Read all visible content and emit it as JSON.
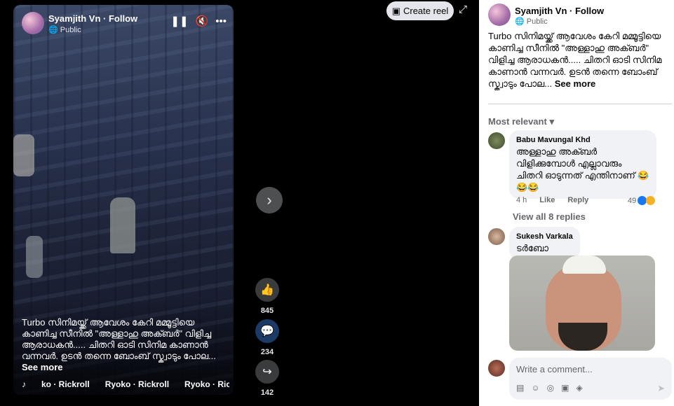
{
  "video": {
    "author": "Syamjith Vn · Follow",
    "privacy": "Public",
    "caption": "Turbo സിനിമയ്ക്ക് ആവേശം കേറി മമ്മൂട്ടിയെ കാണിച്ച സീനിൽ \"അള്ളാഹു അക്ബർ\" വിളിച്ച ആരാധകൻ..... ചിതറി ഓടി സിനിമ കാണാൻ വന്നവർ. ഉടൻ തന്നെ ബോംബ് സ്ക്വാടും പോല...",
    "see_more": "See more",
    "music": [
      "ko · Rickroll",
      "Ryoko · Rickroll",
      "Ryoko · Rickroll"
    ],
    "controls": {
      "pause_icon": "pause-icon",
      "mute_icon": "volume-icon",
      "more_icon": "more-icon"
    }
  },
  "actions": {
    "likes": "845",
    "comments": "234",
    "shares": "142"
  },
  "top": {
    "create_reel": "Create reel"
  },
  "panel": {
    "author": "Syamjith Vn · Follow",
    "privacy": "Public",
    "body": "Turbo സിനിമയ്ക്ക് ആവേശം കേറി മമ്മൂട്ടിയെ കാണിച്ച സീനിൽ \"അള്ളാഹു അക്ബർ\" വിളിച്ച ആരാധകൻ..... ചിതറി ഓടി സിനിമ കാണാൻ വന്നവർ. ഉടൻ തന്നെ ബോംബ് സ്ക്വാടും പോല...",
    "see_more": "See more",
    "sort": "Most relevant"
  },
  "comments": [
    {
      "name": "Babu Mavungal Khd",
      "text": "അള്ളാഹു അക്ബർ വിളിക്കുമ്പോൾ എല്ലാവരും ചിതറി ഓടുന്നത് എന്തിനാണ് 😂😂😂",
      "time": "4 h",
      "like": "Like",
      "reply": "Reply",
      "reactions": "49",
      "view_replies": "View all 8 replies"
    },
    {
      "name": "Sukesh Varkala",
      "text": "ടർബോ"
    }
  ],
  "composer": {
    "placeholder": "Write a comment...",
    "send_icon": "send-icon"
  }
}
